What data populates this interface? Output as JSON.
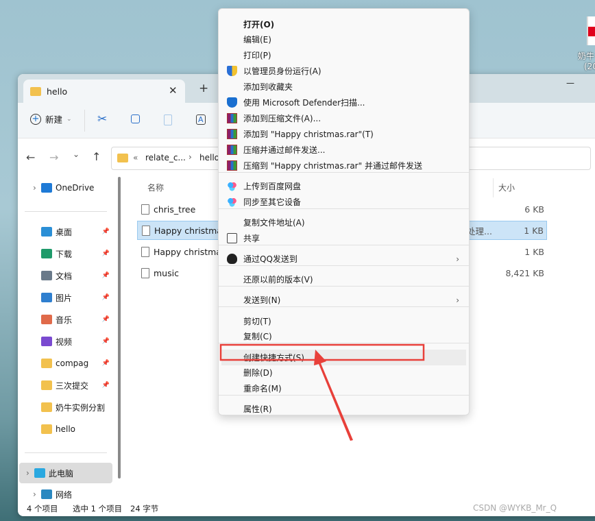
{
  "desktop": {
    "icon_label_1": "奶牛",
    "icon_label_2": "(20"
  },
  "window": {
    "tab_title": "hello",
    "new_tab": "+",
    "minimize": "—"
  },
  "toolbar": {
    "new_label": "新建"
  },
  "address": {
    "overflow": "«",
    "crumbs": [
      "relate_c...",
      "hello"
    ]
  },
  "sidebar": {
    "items": [
      {
        "label": "OneDrive",
        "color": "#1e7ad6",
        "pinned": false
      },
      {
        "label": "桌面",
        "color": "#2b8fd6",
        "pinned": true
      },
      {
        "label": "下载",
        "color": "#1f9a6a",
        "pinned": true
      },
      {
        "label": "文档",
        "color": "#6a7a8a",
        "pinned": true
      },
      {
        "label": "图片",
        "color": "#2f7fcf",
        "pinned": true
      },
      {
        "label": "音乐",
        "color": "#e06a4a",
        "pinned": true
      },
      {
        "label": "视频",
        "color": "#7a4ad0",
        "pinned": true
      },
      {
        "label": "compag",
        "color": "#f2c14e",
        "pinned": true
      },
      {
        "label": "三次提交",
        "color": "#f2c14e",
        "pinned": true
      },
      {
        "label": "奶牛实例分割",
        "color": "#f2c14e",
        "pinned": false
      },
      {
        "label": "hello",
        "color": "#f2c14e",
        "pinned": false
      },
      {
        "label": "此电脑",
        "color": "#2aa8e0",
        "pinned": false
      },
      {
        "label": "网络",
        "color": "#2a88c0",
        "pinned": false
      }
    ]
  },
  "columns": {
    "name": "名称",
    "size": "大小"
  },
  "files": [
    {
      "name": "chris_tree",
      "size": "6 KB",
      "type": ""
    },
    {
      "name": "Happy christmas",
      "size": "1 KB",
      "type": "处理...",
      "selected": true
    },
    {
      "name": "Happy christmas",
      "size": "1 KB",
      "type": ""
    },
    {
      "name": "music",
      "size": "8,421 KB",
      "type": ""
    }
  ],
  "status": {
    "count": "4 个项目",
    "selected": "选中 1 个项目",
    "bytes": "24 字节"
  },
  "watermark": "CSDN @WYKB_Mr_Q",
  "menu": {
    "items": [
      {
        "label": "打开(O)",
        "bold": true,
        "icon": ""
      },
      {
        "label": "编辑(E)",
        "icon": ""
      },
      {
        "label": "打印(P)",
        "icon": ""
      },
      {
        "label": "以管理员身份运行(A)",
        "icon": "uac-shield-icon"
      },
      {
        "label": "添加到收藏夹",
        "icon": ""
      },
      {
        "label": "使用 Microsoft Defender扫描...",
        "icon": "defender-icon"
      },
      {
        "label": "添加到压缩文件(A)...",
        "icon": "winrar-icon"
      },
      {
        "label": "添加到 \"Happy christmas.rar\"(T)",
        "icon": "winrar-icon"
      },
      {
        "label": "压缩并通过邮件发送...",
        "icon": "winrar-icon"
      },
      {
        "label": "压缩到 \"Happy christmas.rar\" 并通过邮件发送",
        "icon": "winrar-icon"
      },
      {
        "label": "上传到百度网盘",
        "icon": "baidu-icon"
      },
      {
        "label": "同步至其它设备",
        "icon": "baidu-icon"
      },
      {
        "label": "复制文件地址(A)",
        "icon": ""
      },
      {
        "label": "共享",
        "icon": "share-icon"
      },
      {
        "label": "通过QQ发送到",
        "icon": "qq-icon",
        "submenu": true
      },
      {
        "label": "还原以前的版本(V)",
        "icon": ""
      },
      {
        "label": "发送到(N)",
        "icon": "",
        "submenu": true
      },
      {
        "label": "剪切(T)",
        "icon": ""
      },
      {
        "label": "复制(C)",
        "icon": ""
      },
      {
        "label": "创建快捷方式(S)",
        "icon": "",
        "highlighted": true
      },
      {
        "label": "删除(D)",
        "icon": ""
      },
      {
        "label": "重命名(M)",
        "icon": ""
      },
      {
        "label": "属性(R)",
        "icon": ""
      }
    ]
  },
  "annotation": {
    "color": "#e8403a"
  }
}
